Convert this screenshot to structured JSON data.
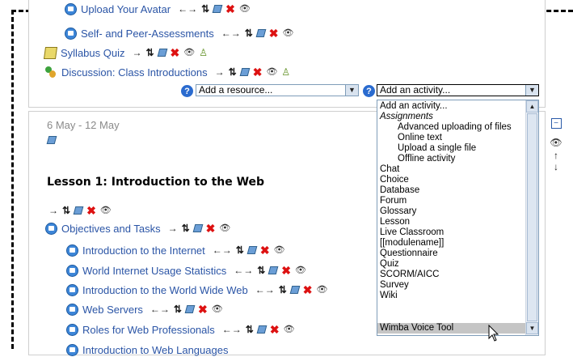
{
  "top_items": [
    {
      "label": "Upload Your Avatar",
      "type": "resource"
    },
    {
      "label": "Self- and Peer-Assessments",
      "type": "resource"
    }
  ],
  "course_items": [
    {
      "label": "Syllabus Quiz",
      "type": "quiz"
    },
    {
      "label": "Discussion: Class Introductions",
      "type": "forum"
    }
  ],
  "add_resource": {
    "value": "Add a resource..."
  },
  "add_activity": {
    "value": "Add an activity..."
  },
  "section": {
    "date": "6 May - 12 May",
    "heading": "Lesson 1: Introduction to the Web",
    "items": [
      {
        "label": "Objectives and Tasks"
      },
      {
        "label": "Introduction to the Internet"
      },
      {
        "label": "World Internet Usage Statistics"
      },
      {
        "label": "Introduction to the World Wide Web"
      },
      {
        "label": "Web Servers"
      },
      {
        "label": "Roles for Web Professionals"
      },
      {
        "label": "Introduction to Web Languages"
      }
    ]
  },
  "activity_options": [
    "Add an activity...",
    "Assignments",
    "Advanced uploading of files",
    "Online text",
    "Upload a single file",
    "Offline activity",
    "Chat",
    "Choice",
    "Database",
    "Forum",
    "Glossary",
    "Lesson",
    "Live Classroom",
    "[[modulename]]",
    "Questionnaire",
    "Quiz",
    "SCORM/AICC",
    "Survey",
    "Wiki",
    "Wimba Voice Tool"
  ],
  "highlighted_option": "Wimba Voice Tool",
  "icons": {
    "move_left_right": "arrows-left-right-icon",
    "move": "move-icon",
    "update": "edit-icon",
    "delete": "delete-icon",
    "hide": "eye-icon",
    "groups": "groups-icon",
    "help": "help-icon",
    "collapse": "collapse-icon"
  },
  "colors": {
    "link": "#2b55a6",
    "delete": "#dd1111",
    "highlight": "#c5c5c5",
    "date": "#8a8a8a"
  }
}
